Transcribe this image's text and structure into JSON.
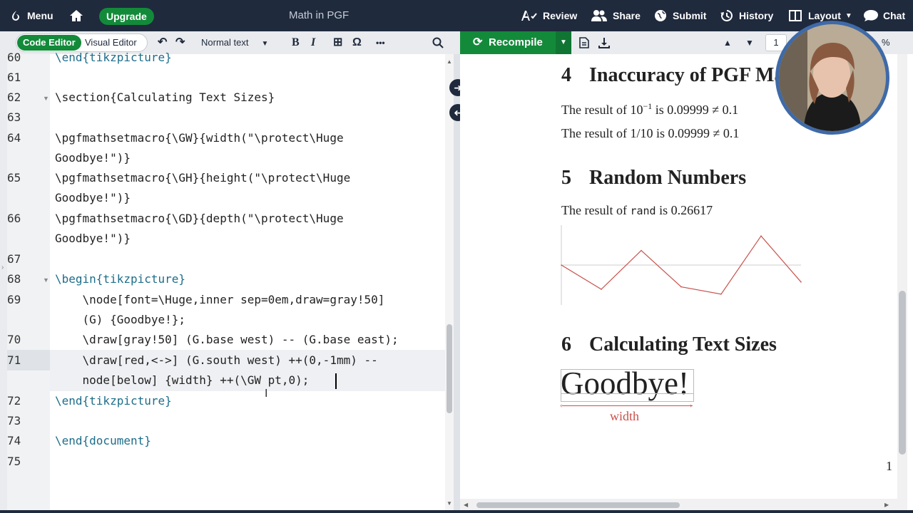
{
  "topbar": {
    "menu_label": "Menu",
    "upgrade_label": "Upgrade",
    "title": "Math in PGF",
    "review_label": "Review",
    "share_label": "Share",
    "submit_label": "Submit",
    "history_label": "History",
    "layout_label": "Layout",
    "chat_label": "Chat"
  },
  "toolbar": {
    "code_editor_label": "Code Editor",
    "visual_editor_label": "Visual Editor",
    "text_style": "Normal text",
    "bold": "B",
    "italic": "I",
    "omega": "Ω",
    "more": "•••",
    "recompile_label": "Recompile",
    "page_number": "1",
    "zoom_suffix": "%"
  },
  "editor": {
    "lines": [
      {
        "num": "60",
        "text": "\\end{tikzpicture}"
      },
      {
        "num": "61",
        "text": ""
      },
      {
        "num": "62",
        "text": "\\section{Calculating Text Sizes}"
      },
      {
        "num": "63",
        "text": ""
      },
      {
        "num": "64",
        "text": "\\pgfmathsetmacro{\\GW}{width(\"\\protect\\Huge",
        "cont": "Goodbye!\")}"
      },
      {
        "num": "65",
        "text": "\\pgfmathsetmacro{\\GH}{height(\"\\protect\\Huge",
        "cont": "Goodbye!\")}"
      },
      {
        "num": "66",
        "text": "\\pgfmathsetmacro{\\GD}{depth(\"\\protect\\Huge",
        "cont": "Goodbye!\")}"
      },
      {
        "num": "67",
        "text": ""
      },
      {
        "num": "68",
        "text": "\\begin{tikzpicture}"
      },
      {
        "num": "69",
        "text": "    \\node[font=\\Huge,inner sep=0em,draw=gray!50]",
        "cont": "    (G) {Goodbye!};"
      },
      {
        "num": "70",
        "text": "    \\draw[gray!50] (G.base west) -- (G.base east);"
      },
      {
        "num": "71",
        "text": "    \\draw[red,<->] (G.south west) ++(0,-1mm) --",
        "cont": "    node[below] {width} ++(\\GW pt,0);"
      },
      {
        "num": "72",
        "text": "\\end{tikzpicture}"
      },
      {
        "num": "73",
        "text": ""
      },
      {
        "num": "74",
        "text": "\\end{document}"
      },
      {
        "num": "75",
        "text": ""
      }
    ]
  },
  "pdf": {
    "sec4_num": "4",
    "sec4_title": "Inaccuracy of PGF Math",
    "sec4_line1_a": "The result of 10",
    "sec4_line1_sup": "−1",
    "sec4_line1_b": " is 0.09999 ≠ 0.1",
    "sec4_line2": "The result of 1/10 is 0.09999 ≠ 0.1",
    "sec5_num": "5",
    "sec5_title": "Random Numbers",
    "sec5_line_a": "The result of ",
    "sec5_line_code": "rand",
    "sec5_line_b": " is 0.26617",
    "sec6_num": "6",
    "sec6_title": "Calculating Text Sizes",
    "goodbye": "Goodbye!",
    "width_label": "width",
    "page_number": "1"
  },
  "chart_data": {
    "type": "line",
    "x": [
      0,
      1,
      2,
      3,
      4,
      5,
      6
    ],
    "y": [
      0,
      -0.5,
      0.3,
      -0.45,
      -0.6,
      0.6,
      -0.35
    ],
    "title": "",
    "xlabel": "",
    "ylabel": "",
    "color": "#c8514b"
  },
  "colors": {
    "topbar_bg": "#1f2a3d",
    "accent_green": "#138a3a",
    "keyword": "#1c6d8a"
  }
}
